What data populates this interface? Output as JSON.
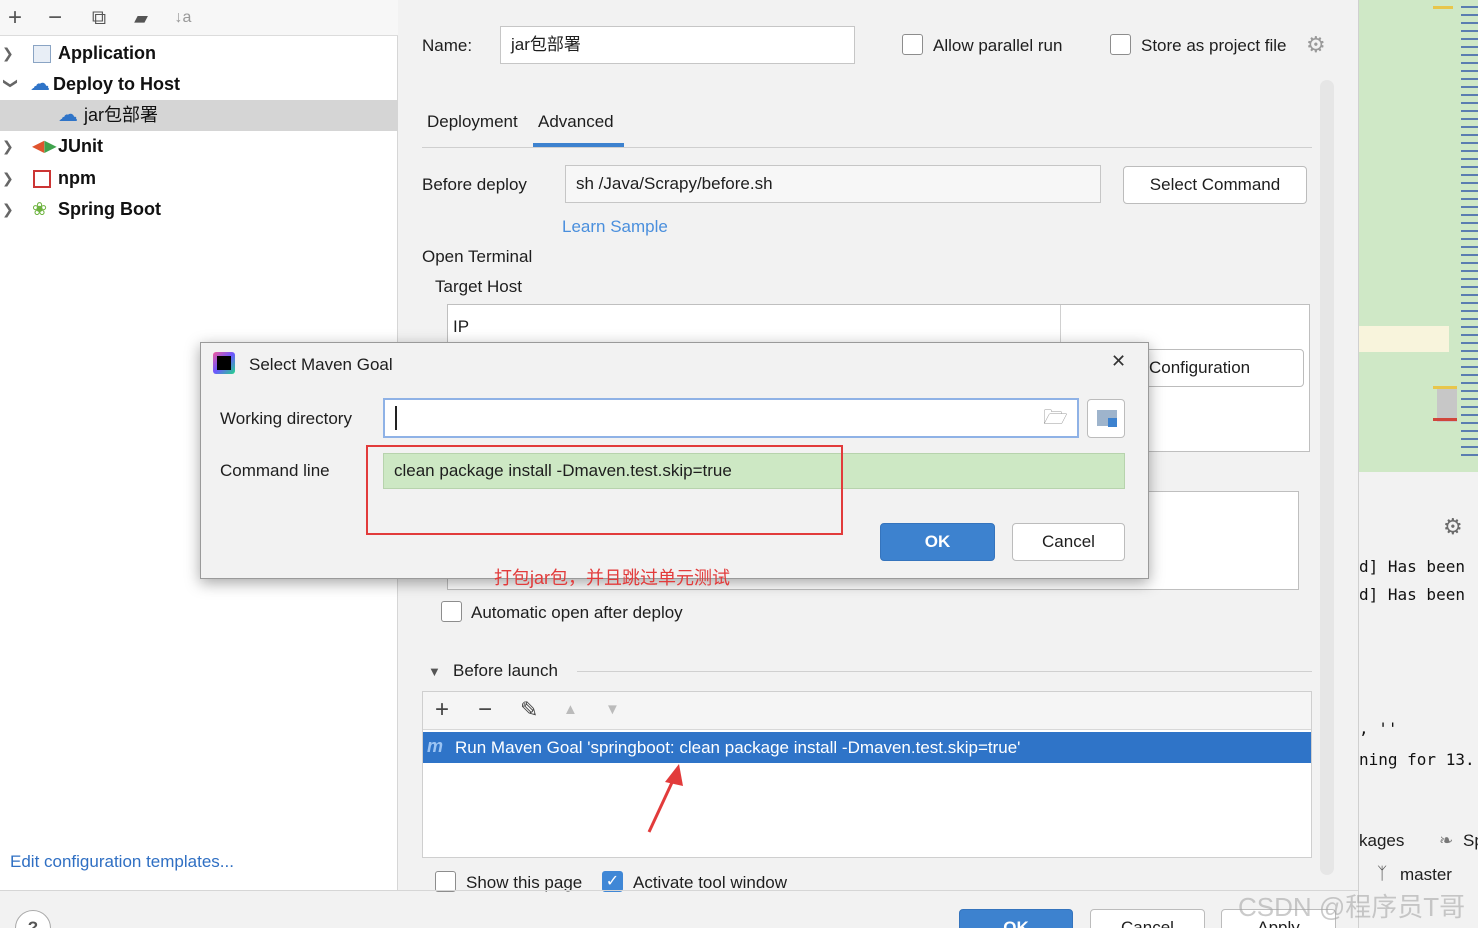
{
  "sidebar": {
    "toolbar": {
      "add": "+",
      "remove": "−",
      "copy": "⧉",
      "folder": "▰",
      "sort": "↓a"
    },
    "items": [
      {
        "label": "Application",
        "icon": "application-icon"
      },
      {
        "label": "Deploy to Host",
        "icon": "cloud-deploy-icon"
      },
      {
        "label": "jar包部署",
        "icon": "cloud-deploy-icon"
      },
      {
        "label": "JUnit",
        "icon": "junit-icon"
      },
      {
        "label": "npm",
        "icon": "npm-icon"
      },
      {
        "label": "Spring Boot",
        "icon": "spring-boot-icon"
      }
    ],
    "edit_templates": "Edit configuration templates...",
    "help": "?"
  },
  "form": {
    "name_label": "Name:",
    "name_value": "jar包部署",
    "allow_parallel": "Allow parallel run",
    "store_as_project": "Store as project file",
    "tabs": [
      "Deployment",
      "Advanced"
    ],
    "active_tab": "Advanced",
    "before_deploy_label": "Before deploy",
    "before_deploy_value": "sh /Java/Scrapy/before.sh",
    "select_command": "Select Command",
    "learn_sample": "Learn Sample",
    "open_terminal": "Open Terminal",
    "target_host": "Target Host",
    "ip_header": "IP",
    "configuration_btn": "Configuration",
    "auto_open": "Automatic open after deploy",
    "before_launch": "Before launch",
    "bl_toolbar": {
      "add": "+",
      "remove": "−",
      "edit": "✎",
      "up": "▲",
      "down": "▼"
    },
    "run_maven_goal": "Run Maven Goal 'springboot: clean package install -Dmaven.test.skip=true'",
    "show_this_page": "Show this page",
    "activate_tool_window": "Activate tool window",
    "ok": "OK",
    "cancel": "Cancel",
    "apply": "Apply"
  },
  "dialog": {
    "title": "Select Maven Goal",
    "close": "✕",
    "working_dir_label": "Working directory",
    "working_dir_value": "",
    "command_line_label": "Command line",
    "command_line_value": "clean package install -Dmaven.test.skip=true",
    "ok": "OK",
    "cancel": "Cancel"
  },
  "annotation": "打包jar包，并且跳过单元测试",
  "edge": {
    "log_lines": [
      "d] Has been",
      "d] Has been",
      ", ''",
      "ning for 13."
    ],
    "packages": "kages",
    "sp": "Sp",
    "branch": "master",
    "watermark": "CSDN @程序员T哥"
  },
  "colors": {
    "accent": "#3d82cf",
    "selection_blue": "#2f74c8",
    "annotation_red": "#e23b3b",
    "command_green": "#cde8c4"
  }
}
